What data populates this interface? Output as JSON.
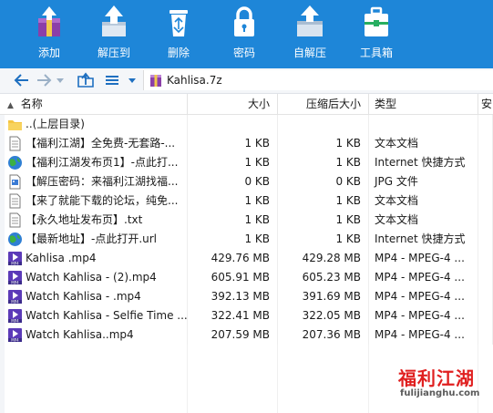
{
  "toolbar": {
    "buttons": [
      {
        "label": "添加",
        "icon": "add-archive-icon"
      },
      {
        "label": "解压到",
        "icon": "extract-to-icon"
      },
      {
        "label": "删除",
        "icon": "recycle-bin-icon"
      },
      {
        "label": "密码",
        "icon": "padlock-icon"
      },
      {
        "label": "自解压",
        "icon": "self-extract-icon"
      },
      {
        "label": "工具箱",
        "icon": "toolbox-icon"
      }
    ],
    "color": "#1e86d8"
  },
  "address": {
    "path": "Kahlisa.7z"
  },
  "columns": {
    "name": "名称",
    "size": "大小",
    "packed": "压缩后大小",
    "type": "类型",
    "more": "安"
  },
  "rows": [
    {
      "name": "..(上层目录)",
      "size": "",
      "packed": "",
      "type": "",
      "icon": "folder-icon"
    },
    {
      "name": "【福利江湖】全免费-无套路-...",
      "size": "1 KB",
      "packed": "1 KB",
      "type": "文本文档",
      "icon": "text-file-icon"
    },
    {
      "name": "【福利江湖发布页1】-点此打...",
      "size": "1 KB",
      "packed": "1 KB",
      "type": "Internet 快捷方式",
      "icon": "internet-shortcut-icon"
    },
    {
      "name": "【解压密码：来福利江湖找福...",
      "size": "0 KB",
      "packed": "0 KB",
      "type": "JPG 文件",
      "icon": "image-file-icon"
    },
    {
      "name": "【来了就能下载的论坛，纯免...",
      "size": "1 KB",
      "packed": "1 KB",
      "type": "文本文档",
      "icon": "text-file-icon"
    },
    {
      "name": "【永久地址发布页】.txt",
      "size": "1 KB",
      "packed": "1 KB",
      "type": "文本文档",
      "icon": "text-file-icon"
    },
    {
      "name": "【最新地址】-点此打开.url",
      "size": "1 KB",
      "packed": "1 KB",
      "type": "Internet 快捷方式",
      "icon": "internet-shortcut-icon"
    },
    {
      "name": "Kahlisa .mp4",
      "size": "429.76 MB",
      "packed": "429.28 MB",
      "type": "MP4 - MPEG-4 ...",
      "icon": "mp4-file-icon"
    },
    {
      "name": "Watch Kahlisa -  (2).mp4",
      "size": "605.91 MB",
      "packed": "605.23 MB",
      "type": "MP4 - MPEG-4 ...",
      "icon": "mp4-file-icon"
    },
    {
      "name": "Watch Kahlisa - .mp4",
      "size": "392.13 MB",
      "packed": "391.69 MB",
      "type": "MP4 - MPEG-4 ...",
      "icon": "mp4-file-icon"
    },
    {
      "name": "Watch Kahlisa - Selfie Time ...",
      "size": "322.41 MB",
      "packed": "322.05 MB",
      "type": "MP4 - MPEG-4 ...",
      "icon": "mp4-file-icon"
    },
    {
      "name": "Watch Kahlisa..mp4",
      "size": "207.59 MB",
      "packed": "207.36 MB",
      "type": "MP4 - MPEG-4 ...",
      "icon": "mp4-file-icon"
    }
  ],
  "watermark": {
    "title": "福利江湖",
    "url": "fulijianghu.com"
  }
}
